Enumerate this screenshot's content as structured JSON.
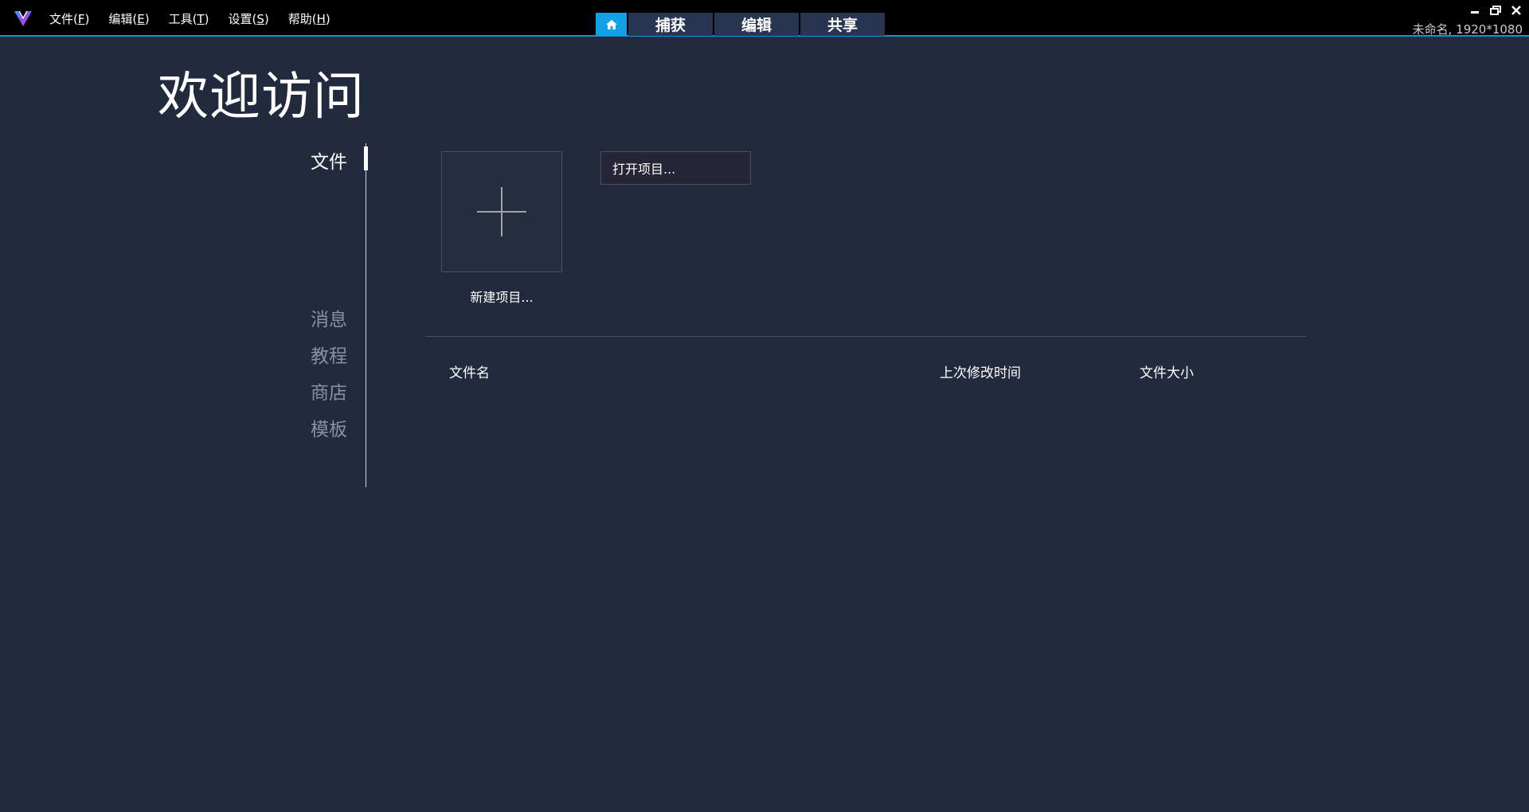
{
  "app": {
    "status": "未命名, 1920*1080"
  },
  "menu": [
    {
      "label": "文件(",
      "accel": "F",
      "close": ")"
    },
    {
      "label": "编辑(",
      "accel": "E",
      "close": ")"
    },
    {
      "label": "工具(",
      "accel": "T",
      "close": ")"
    },
    {
      "label": "设置(",
      "accel": "S",
      "close": ")"
    },
    {
      "label": "帮助(",
      "accel": "H",
      "close": ")"
    }
  ],
  "modes": {
    "capture": "捕获",
    "edit": "编辑",
    "share": "共享"
  },
  "page": {
    "title": "欢迎访问"
  },
  "side_nav": [
    {
      "label": "文件",
      "active": true
    },
    {
      "label": "消息",
      "active": false
    },
    {
      "label": "教程",
      "active": false
    },
    {
      "label": "商店",
      "active": false
    },
    {
      "label": "模板",
      "active": false
    }
  ],
  "actions": {
    "new_project": "新建项目...",
    "open_project": "打开项目..."
  },
  "file_table": {
    "columns": [
      "文件名",
      "上次修改时间",
      "文件大小"
    ]
  },
  "colors": {
    "background": "#222a3e",
    "titlebar": "#000000",
    "accent": "#12a0e8",
    "tab": "#283550"
  }
}
